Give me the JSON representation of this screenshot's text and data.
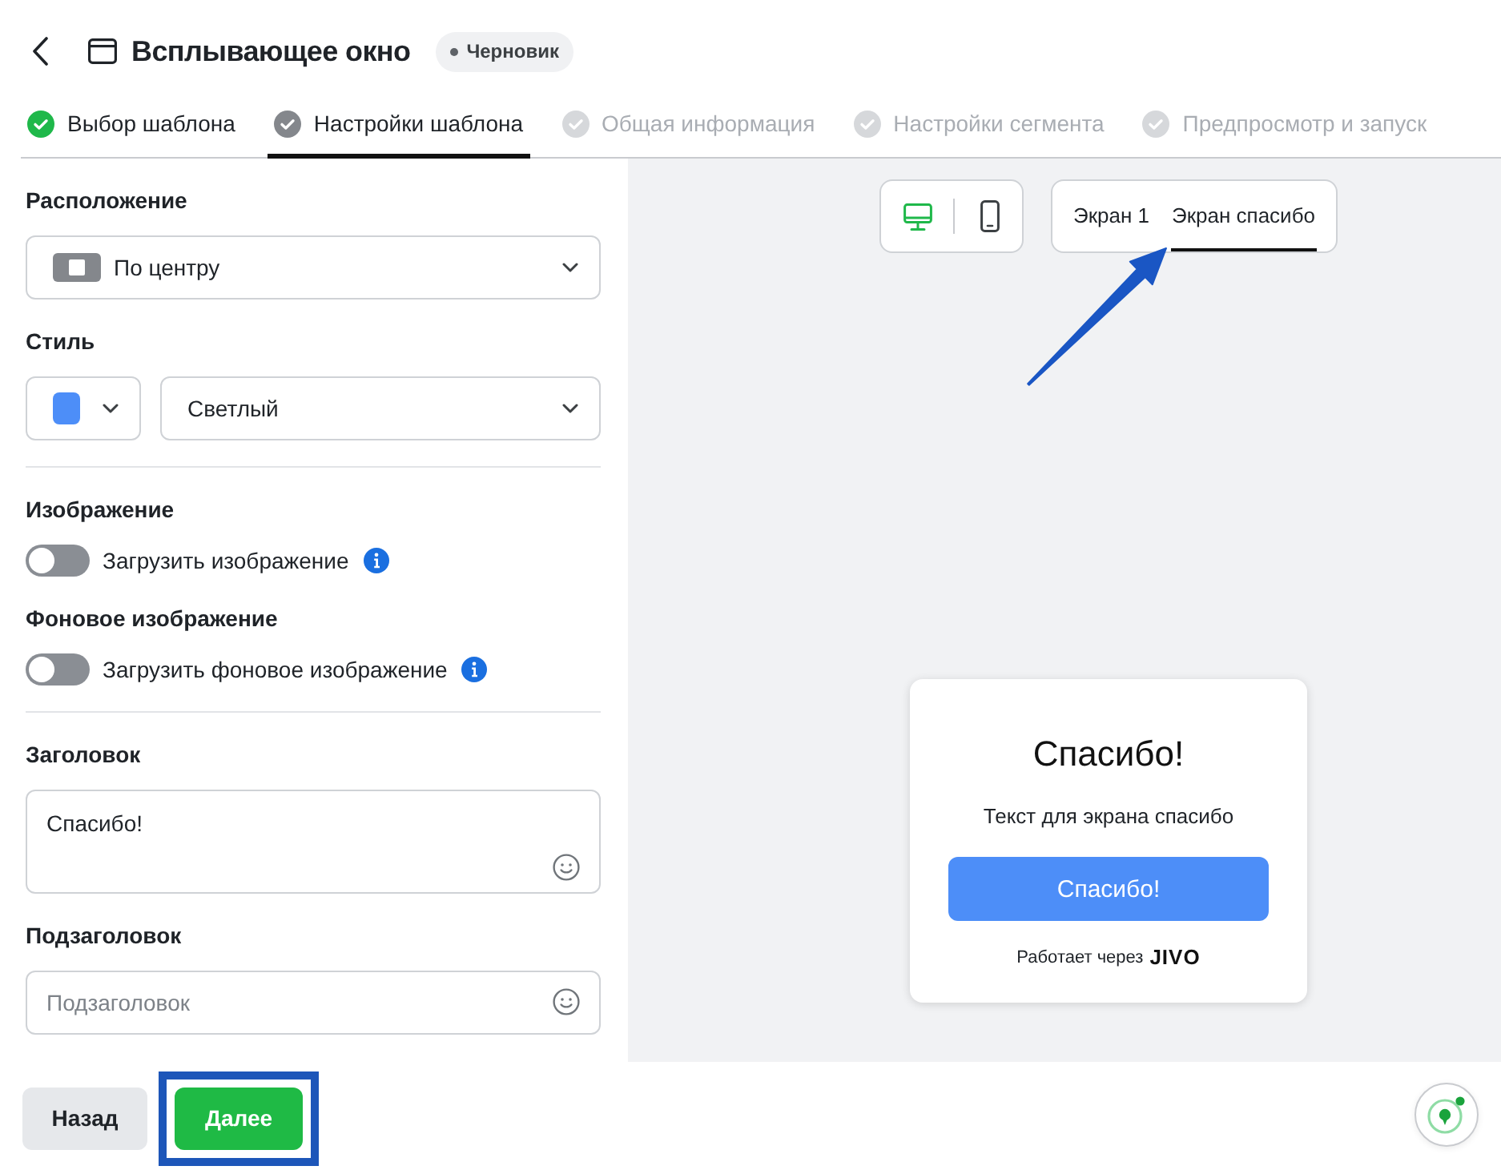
{
  "header": {
    "title": "Всплывающее окно",
    "badge": "Черновик"
  },
  "steps": [
    {
      "label": "Выбор шаблона",
      "completed": true,
      "selected": false
    },
    {
      "label": "Настройки шаблона",
      "completed": false,
      "selected": true
    },
    {
      "label": "Общая информация",
      "completed": false,
      "selected": false
    },
    {
      "label": "Настройки сегмента",
      "completed": false,
      "selected": false
    },
    {
      "label": "Предпросмотр и запуск",
      "completed": false,
      "selected": false
    }
  ],
  "settings": {
    "placement": {
      "label": "Расположение",
      "value": "По центру"
    },
    "style": {
      "label": "Стиль",
      "color": "#4d8ef8",
      "value": "Светлый"
    },
    "image": {
      "label": "Изображение",
      "toggle_label": "Загрузить изображение",
      "on": false
    },
    "background_image": {
      "label": "Фоновое изображение",
      "toggle_label": "Загрузить фоновое изображение",
      "on": false
    },
    "title_field": {
      "label": "Заголовок",
      "value": "Спасибо!"
    },
    "subtitle_field": {
      "label": "Подзаголовок",
      "placeholder": "Подзаголовок"
    }
  },
  "preview": {
    "devices": [
      {
        "kind": "desktop",
        "selected": true
      },
      {
        "kind": "mobile",
        "selected": false
      }
    ],
    "screens": [
      {
        "label": "Экран 1",
        "selected": false
      },
      {
        "label": "Экран спасибо",
        "selected": true
      }
    ],
    "popup": {
      "title": "Спасибо!",
      "text": "Текст для экрана спасибо",
      "button": "Спасибо!",
      "powered_by": "Работает через",
      "brand": "JIVO"
    }
  },
  "footer": {
    "back": "Назад",
    "next": "Далее"
  }
}
